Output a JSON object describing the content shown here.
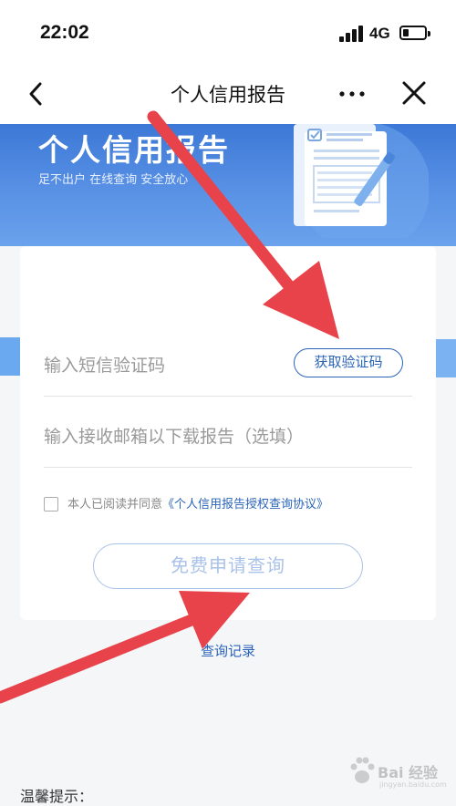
{
  "status_bar": {
    "time": "22:02",
    "network": "4G"
  },
  "nav": {
    "title": "个人信用报告",
    "back_icon": "chevron-left-icon",
    "more_icon": "more-dots-icon",
    "close_icon": "close-icon"
  },
  "banner": {
    "title": "个人信用报告",
    "subtitle": "足不出户 在线查询 安全放心"
  },
  "form": {
    "sms_code_placeholder": "输入短信验证码",
    "get_code_label": "获取验证码",
    "email_placeholder": "输入接收邮箱以下载报告（选填）",
    "agree_prefix": "本人已阅读并同意",
    "agree_link": "《个人信用报告授权查询协议》",
    "submit_label": "免费申请查询"
  },
  "records_link": "查询记录",
  "tip_title": "温馨提示：",
  "watermark": {
    "text": "Bai 经验",
    "sub": "jingyan.baidu.com"
  },
  "colors": {
    "banner_blue": "#3c78d6",
    "link_blue": "#2a63b8",
    "disabled_button": "#a9c2e8",
    "annotation_red": "#e8434b"
  }
}
